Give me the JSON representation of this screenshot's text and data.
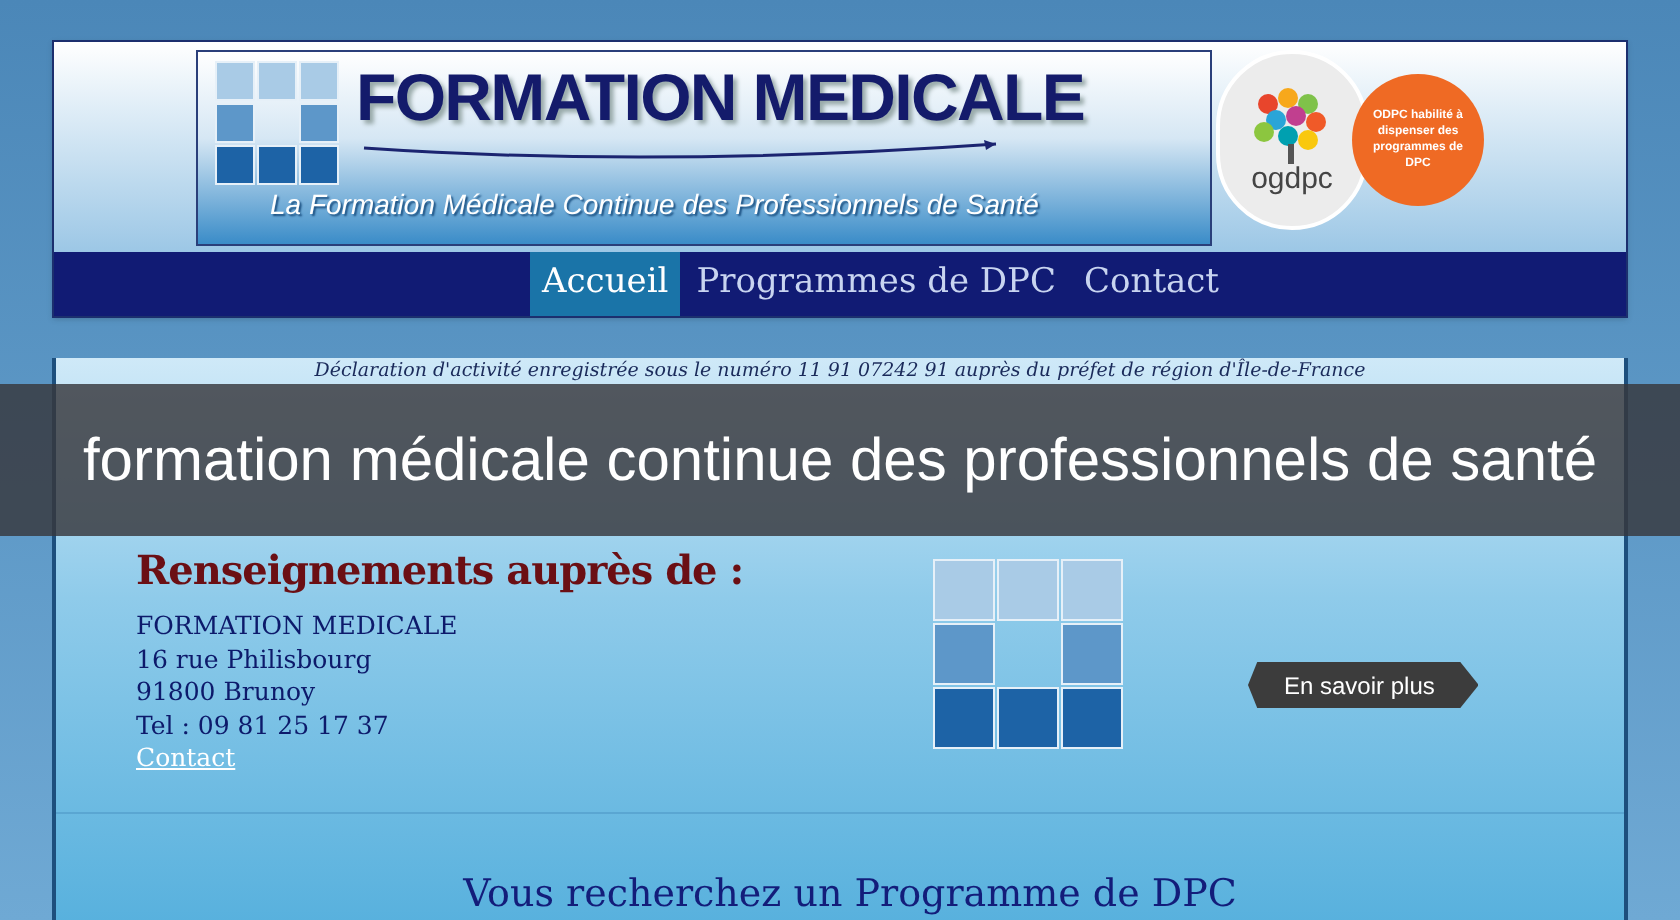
{
  "header": {
    "title": "FORMATION MEDICALE",
    "tagline": "La  Formation Médicale Continue des Professionnels de Santé",
    "logo_text": "ogdpc",
    "badge": "ODPC habilité à dispenser des programmes de DPC"
  },
  "nav": [
    {
      "label": "Accueil",
      "selected": true
    },
    {
      "label": "Programmes de DPC",
      "selected": false
    },
    {
      "label": "Contact",
      "selected": false
    }
  ],
  "declaration": "Déclaration d'activité enregistrée sous le numéro 11 91 07242 91 auprès du préfet de région d'Île-de-France",
  "overlay_caption": "formation médicale continue des professionnels de santé",
  "contact": {
    "heading": "Renseignements auprès de :",
    "lines": [
      "FORMATION MEDICALE",
      "16 rue Philisbourg",
      "91800 Brunoy",
      "Tel : 09 81 25 17 37"
    ],
    "link": "Contact"
  },
  "more_button": "En savoir plus",
  "section_title": "Vous recherchez un Programme de DPC"
}
